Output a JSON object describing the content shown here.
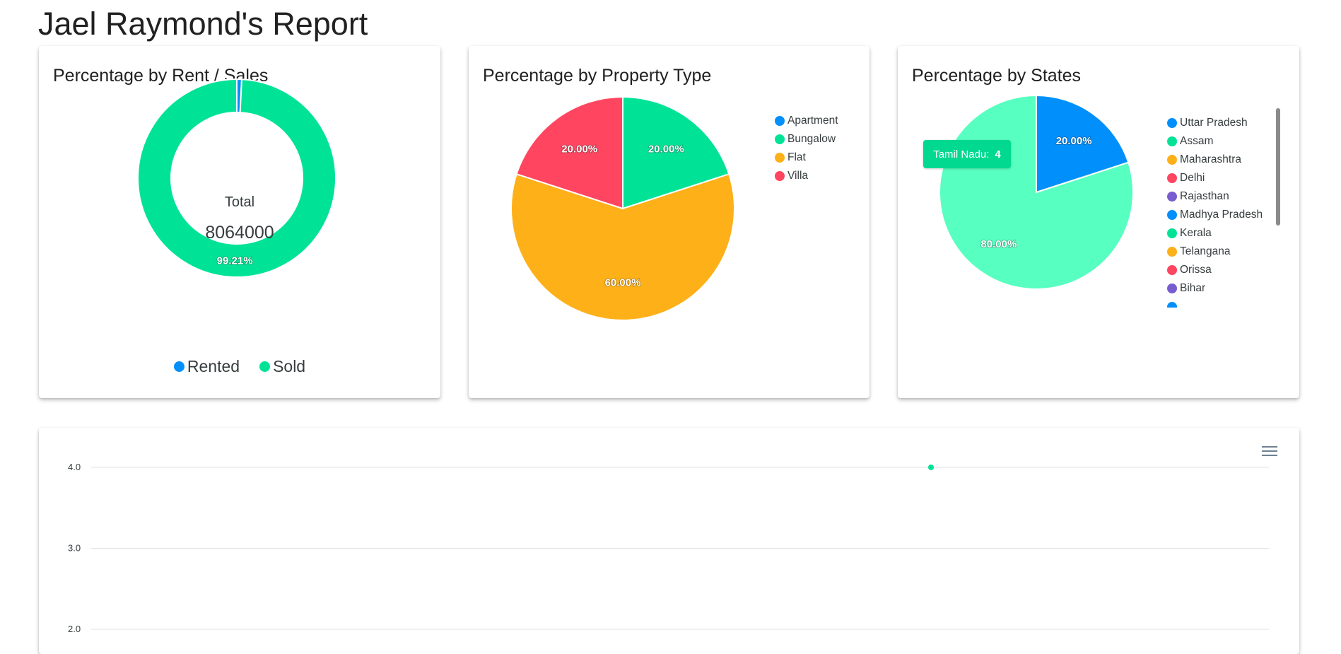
{
  "page": {
    "title": "Jael Raymond's Report"
  },
  "colors": {
    "blue": "#008ffb",
    "green": "#00e396",
    "orange": "#feb019",
    "red": "#ff4560",
    "purple": "#775dd0",
    "mint": "#57ffc1",
    "tooltip_bg": "#00d98f"
  },
  "rent_sales": {
    "title": "Percentage by Rent / Sales",
    "total_label": "Total",
    "total_value": "8064000",
    "chart_data": {
      "type": "donut",
      "categories": [
        "Rented",
        "Sold"
      ],
      "values": [
        0.79,
        99.21
      ],
      "data_labels": [
        "",
        "99.21%"
      ],
      "colors": [
        "#008ffb",
        "#00e396"
      ],
      "legend": "bottom"
    },
    "legend": [
      {
        "label": "Rented",
        "color": "#008ffb"
      },
      {
        "label": "Sold",
        "color": "#00e396"
      }
    ]
  },
  "property_type": {
    "title": "Percentage by Property Type",
    "chart_data": {
      "type": "pie",
      "categories": [
        "Apartment",
        "Bungalow",
        "Flat",
        "Villa"
      ],
      "values": [
        0,
        20,
        60,
        20
      ],
      "data_labels": [
        "",
        "20.00%",
        "60.00%",
        "20.00%"
      ],
      "colors": [
        "#008ffb",
        "#00e396",
        "#feb019",
        "#ff4560"
      ],
      "legend": "right"
    },
    "legend": [
      {
        "label": "Apartment",
        "color": "#008ffb"
      },
      {
        "label": "Bungalow",
        "color": "#00e396"
      },
      {
        "label": "Flat",
        "color": "#feb019"
      },
      {
        "label": "Villa",
        "color": "#ff4560"
      }
    ]
  },
  "states": {
    "title": "Percentage by States",
    "tooltip": {
      "label": "Tamil Nadu:",
      "value": "4"
    },
    "chart_data": {
      "type": "pie",
      "categories": [
        "Uttar Pradesh",
        "Tamil Nadu"
      ],
      "values": [
        20,
        80
      ],
      "data_labels": [
        "20.00%",
        "80.00%"
      ],
      "colors": [
        "#008ffb",
        "#57ffc1"
      ],
      "legend": "right"
    },
    "legend": [
      {
        "label": "Uttar Pradesh",
        "color": "#008ffb"
      },
      {
        "label": "Assam",
        "color": "#00e396"
      },
      {
        "label": "Maharashtra",
        "color": "#feb019"
      },
      {
        "label": "Delhi",
        "color": "#ff4560"
      },
      {
        "label": "Rajasthan",
        "color": "#775dd0"
      },
      {
        "label": "Madhya Pradesh",
        "color": "#008ffb"
      },
      {
        "label": "Kerala",
        "color": "#00e396"
      },
      {
        "label": "Telangana",
        "color": "#feb019"
      },
      {
        "label": "Orissa",
        "color": "#ff4560"
      },
      {
        "label": "Bihar",
        "color": "#775dd0"
      },
      {
        "label": "",
        "color": "#008ffb"
      }
    ]
  },
  "trend": {
    "menu_icon": "hamburger-icon",
    "chart_data": {
      "type": "line",
      "y_ticks": [
        "4.0",
        "3.0",
        "2.0"
      ],
      "ylim": [
        2.0,
        4.0
      ],
      "grid": true,
      "series": [
        {
          "values": [
            4.0
          ],
          "color": "#00e396"
        }
      ]
    }
  }
}
